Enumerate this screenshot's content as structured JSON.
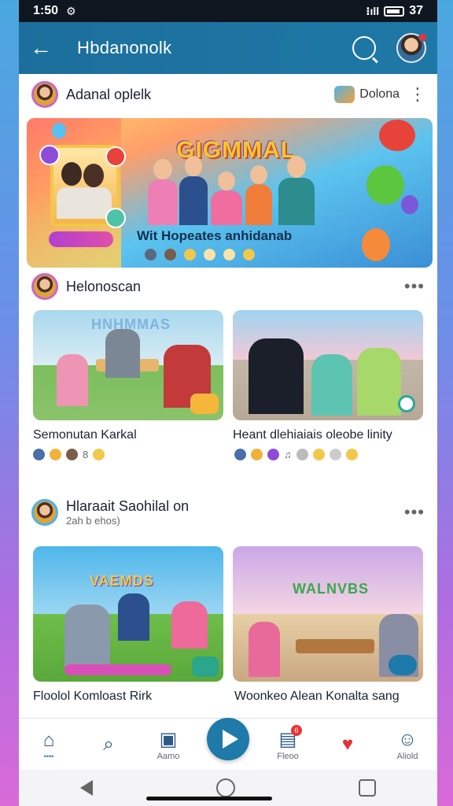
{
  "status_bar": {
    "time": "1:50",
    "signal": "⁝ıll",
    "battery_level": "37"
  },
  "app_bar": {
    "title": "Hbdanonolk",
    "back_icon": "arrow-left-icon",
    "search_icon": "search-icon"
  },
  "feed_header": {
    "title": "Adanal oplelk",
    "chip_label": "Dolona"
  },
  "banner": {
    "title": "GIGMMAL",
    "subtitle": "Wit Hopeates anhidanab",
    "pill_label": ""
  },
  "section1": {
    "title": "Helonoscan",
    "cards": [
      {
        "title": "Semonutan Karkal",
        "tag": "HNHMMAS",
        "count": "8"
      },
      {
        "title": "Heant dlehiaiais oleobe linity",
        "count": ""
      }
    ]
  },
  "section2": {
    "title": "Hlaraait Saohilal on",
    "subtitle": "2ah b ehos)",
    "cards": [
      {
        "title": "Floolol Komloast Rirk",
        "tag": "VAEMDS"
      },
      {
        "title": "Woonkeo Alean Konalta sang",
        "tag": "WALNVBS"
      }
    ]
  },
  "bottom_nav": [
    {
      "label": "",
      "icon": "home-icon"
    },
    {
      "label": "",
      "icon": "search-icon"
    },
    {
      "label": "Aamo",
      "icon": "message-icon"
    },
    {
      "label": "",
      "icon": "play-icon"
    },
    {
      "label": "Fleoo",
      "icon": "notification-icon",
      "badge": "6"
    },
    {
      "label": "",
      "icon": "heart-icon"
    },
    {
      "label": "Aliold",
      "icon": "profile-icon"
    }
  ],
  "colors": {
    "primary": "#1e78a6",
    "accent": "#c867c8",
    "badge": "#e33333"
  }
}
